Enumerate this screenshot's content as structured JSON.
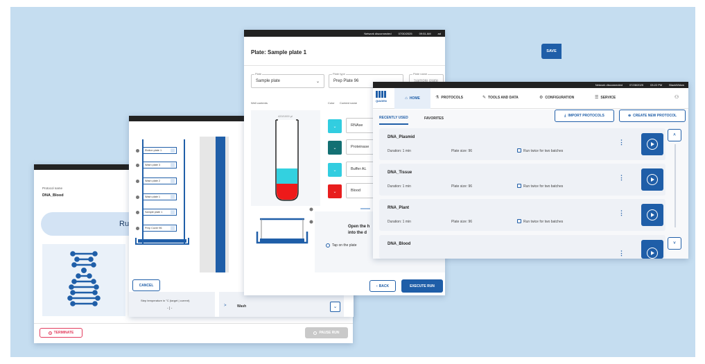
{
  "panel_blood": {
    "protocol_name_label": "Protocol name",
    "protocol_name": "DNA_Blood",
    "run_banner": "Run in p",
    "terminate": "TERMINATE",
    "pause_run": "PAUSE RUN"
  },
  "panel_plates": {
    "run_label": "Ru",
    "slots": [
      "Elution plate 1",
      "Wash plate 3",
      "Wash plate 2",
      "Wash plate 1",
      "Sample plate 1",
      "Prep Cover 96"
    ],
    "cancel": "CANCEL",
    "step_temp_label": "Step temperature in °C (target | current)",
    "step_temp_value": "- | -",
    "step_chevron": ">",
    "wash_label": "Wash",
    "chevron_down": "⌄"
  },
  "panel_plate": {
    "status": {
      "network": "Network disconnected",
      "date": "07/30/2025",
      "time": "09:51 AM",
      "user": "ad"
    },
    "title": "Plate: Sample plate 1",
    "close": "×",
    "save": "SAVE",
    "plate_label": "Plate",
    "plate_value": "Sample plate",
    "plate_type_label": "Plate type",
    "plate_type_value": "Prep Plate 96",
    "plate_name_label": "Plate name",
    "plate_name_value": "Sample plate 1",
    "well_contents": "Well contents",
    "color_label": "Color",
    "content_name_label": "Content name",
    "volume": "420/1000 µl",
    "wells": [
      {
        "name": "RNAse",
        "color": "#32cde0"
      },
      {
        "name": "Proteinase",
        "color": "#137073"
      },
      {
        "name": "Buffer AL",
        "color": "#32cde0"
      },
      {
        "name": "Blood",
        "color": "#e81e1e"
      }
    ],
    "instruction": "Open the h into the d",
    "tap_hint": "Tap on the plate",
    "back": "BACK",
    "execute_run": "EXECUTE RUN"
  },
  "panel_home": {
    "status": {
      "network": "Network disconnected",
      "date": "07/28/2025",
      "time": "03:22 PM",
      "user": "BlackWidow"
    },
    "logo": "QIAGEN",
    "nav": [
      "HOME",
      "PROTOCOLS",
      "TOOLS AND DATA",
      "CONFIGURATION",
      "SERVICE"
    ],
    "tabs": [
      "RECENTLY USED",
      "FAVORITES"
    ],
    "import_protocols": "IMPORT PROTOCOLS",
    "create_new_protocol": "CREATE NEW PROTOCOL",
    "protocols": [
      {
        "name": "DNA_Plasmid",
        "duration": "Duration: 1 min",
        "plate": "Plate size: 96",
        "twice": "Run twice for two batches"
      },
      {
        "name": "DNA_Tissue",
        "duration": "Duration: 1 min",
        "plate": "Plate size: 96",
        "twice": "Run twice for two batches"
      },
      {
        "name": "RNA_Plant",
        "duration": "Duration: 1 min",
        "plate": "Plate size: 96",
        "twice": "Run twice for two batches"
      },
      {
        "name": "DNA_Blood",
        "duration": "",
        "plate": "",
        "twice": ""
      }
    ]
  }
}
